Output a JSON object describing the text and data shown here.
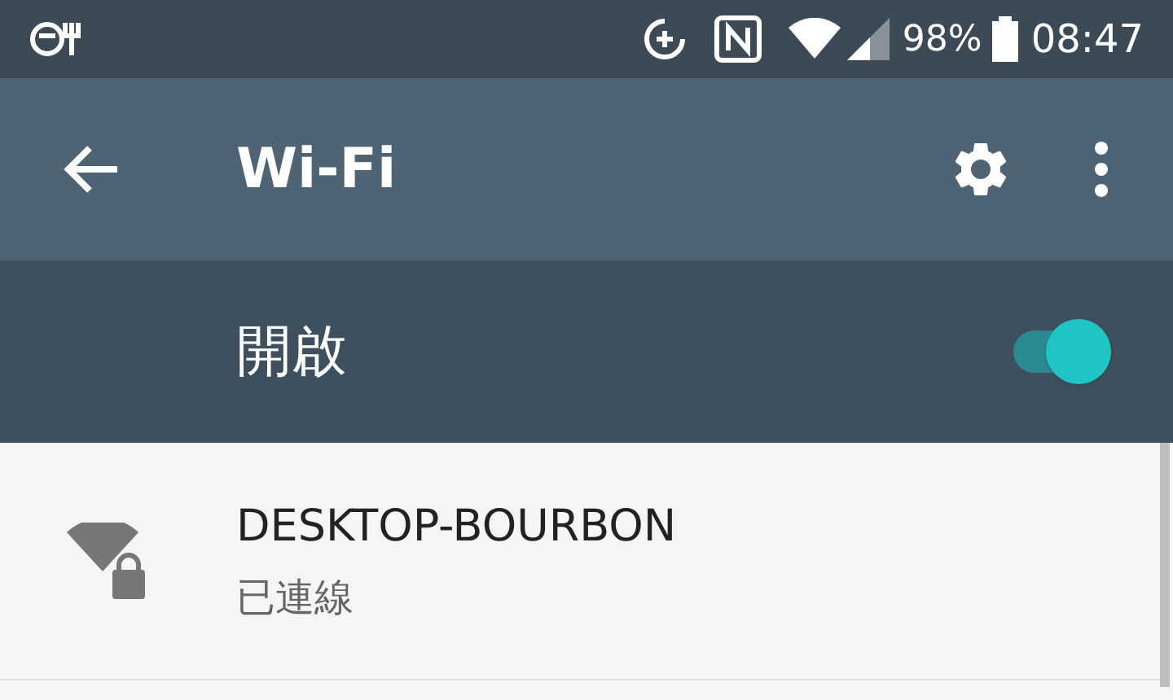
{
  "status_bar": {
    "battery": "98%",
    "time": "08:47"
  },
  "app_bar": {
    "title": "Wi-Fi"
  },
  "master_switch": {
    "label": "開啟",
    "on": true
  },
  "networks": [
    {
      "name": "DESKTOP-BOURBON",
      "status": "已連線",
      "secured": true
    }
  ]
}
